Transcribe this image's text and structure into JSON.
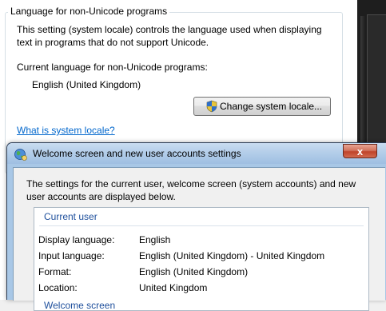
{
  "background_dialog": {
    "group_title": "Language for non-Unicode programs",
    "description": "This setting (system locale) controls the language used when displaying text in programs that do not support Unicode.",
    "current_language_label": "Current language for non-Unicode programs:",
    "current_language_value": "English (United Kingdom)",
    "change_locale_button": "Change system locale...",
    "what_is_link": "What is system locale?"
  },
  "welcome_dialog": {
    "title": "Welcome screen and new user accounts settings",
    "close_symbol": "x",
    "description": "The settings for the current user, welcome screen (system accounts) and new user accounts are displayed below.",
    "current_user": {
      "heading": "Current user",
      "rows": [
        {
          "label": "Display language:",
          "value": "English"
        },
        {
          "label": "Input language:",
          "value": "English (United Kingdom) - United Kingdom"
        },
        {
          "label": "Format:",
          "value": "English (United Kingdom)"
        },
        {
          "label": "Location:",
          "value": "United Kingdom"
        }
      ]
    },
    "welcome_screen": {
      "heading": "Welcome screen"
    }
  },
  "colors": {
    "link": "#0066cc",
    "section_heading": "#1e4f9c",
    "title_bar": "#b6cfea",
    "close_button": "#c0442a"
  }
}
